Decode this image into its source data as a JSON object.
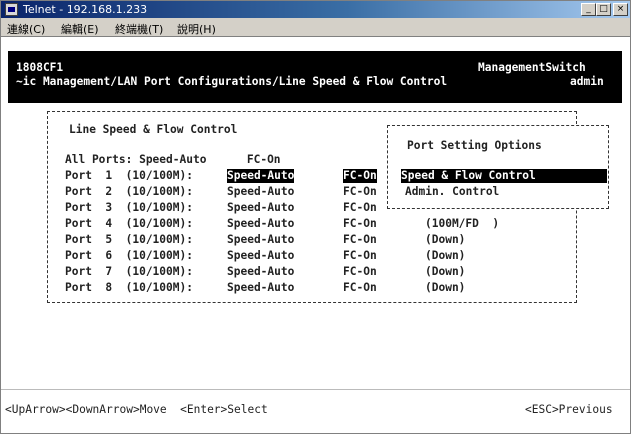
{
  "window": {
    "title": "Telnet - 192.168.1.233"
  },
  "menu": [
    "連線(C)",
    "編輯(E)",
    "終端機(T)",
    "說明(H)"
  ],
  "window_controls": {
    "minimize": "_",
    "maximize": "□",
    "close": "×"
  },
  "header": {
    "model": "1808CF1",
    "product": "ManagementSwitch",
    "path": "~ic Management/LAN Port Configurations/Line Speed & Flow Control",
    "user": "admin"
  },
  "panel": {
    "title": "Line Speed & Flow Control",
    "all_ports": "All Ports: Speed-Auto      FC-On",
    "ports": [
      {
        "label": "Port  1  (10/100M):",
        "speed": "Speed-Auto",
        "fc": "FC-On",
        "status": ""
      },
      {
        "label": "Port  2  (10/100M):",
        "speed": "Speed-Auto",
        "fc": "FC-On",
        "status": ""
      },
      {
        "label": "Port  3  (10/100M):",
        "speed": "Speed-Auto",
        "fc": "FC-On",
        "status": ""
      },
      {
        "label": "Port  4  (10/100M):",
        "speed": "Speed-Auto",
        "fc": "FC-On",
        "status": "(100M/FD  )"
      },
      {
        "label": "Port  5  (10/100M):",
        "speed": "Speed-Auto",
        "fc": "FC-On",
        "status": "(Down)"
      },
      {
        "label": "Port  6  (10/100M):",
        "speed": "Speed-Auto",
        "fc": "FC-On",
        "status": "(Down)"
      },
      {
        "label": "Port  7  (10/100M):",
        "speed": "Speed-Auto",
        "fc": "FC-On",
        "status": "(Down)"
      },
      {
        "label": "Port  8  (10/100M):",
        "speed": "Speed-Auto",
        "fc": "FC-On",
        "status": "(Down)"
      }
    ]
  },
  "options": {
    "title": "Port Setting Options",
    "items": [
      "Speed & Flow Control",
      "Admin. Control"
    ],
    "selected_index": 0
  },
  "footer": {
    "keys": "<UpArrow><DownArrow>Move  <Enter>Select",
    "esc": "<ESC>Previous"
  }
}
